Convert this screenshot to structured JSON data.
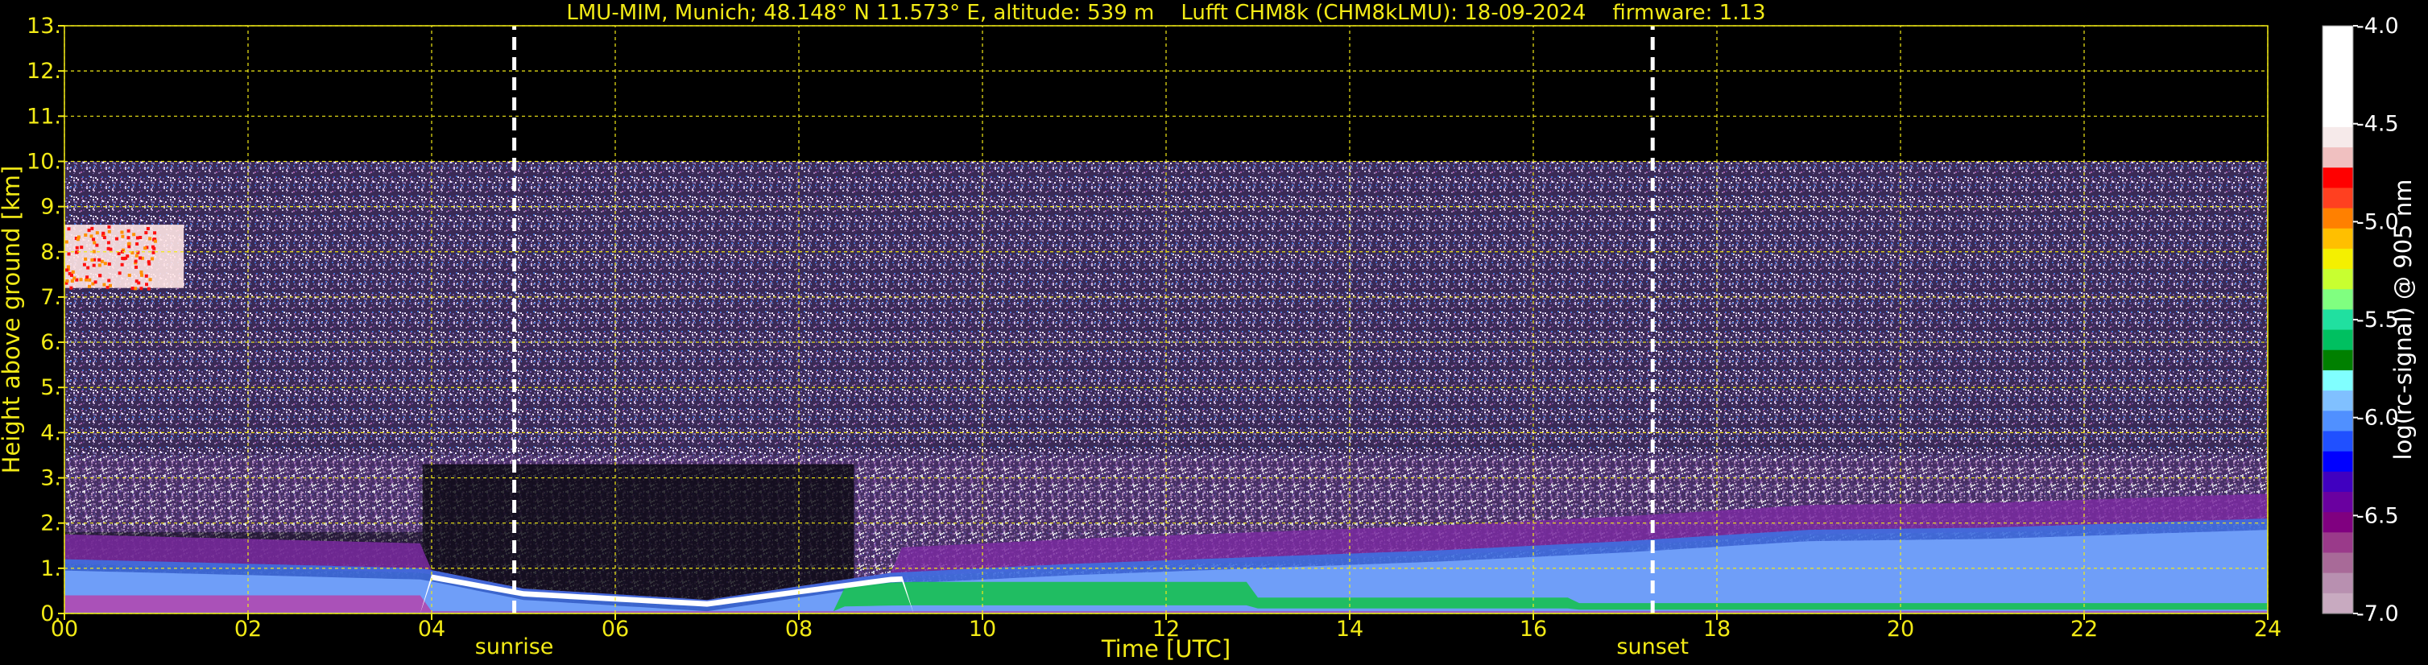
{
  "chart_data": {
    "type": "heatmap",
    "title": "LMU-MIM, Munich; 48.148° N 11.573° E, altitude: 539 m    Lufft CHM8k (CHM8kLMU): 18-09-2024    firmware: 1.13",
    "xlabel": "Time [UTC]",
    "ylabel": "Height above ground [km]",
    "colorbar_label": "log(rc-signal) @ 905 nm",
    "xlim": [
      0,
      24
    ],
    "ylim": [
      0,
      13
    ],
    "x_ticks": [
      0,
      2,
      4,
      6,
      8,
      10,
      12,
      14,
      16,
      18,
      20,
      22,
      24
    ],
    "x_tick_labels": [
      "00",
      "02",
      "04",
      "06",
      "08",
      "10",
      "12",
      "14",
      "16",
      "18",
      "20",
      "22",
      "24"
    ],
    "y_ticks": [
      0,
      1,
      2,
      3,
      4,
      5,
      6,
      7,
      8,
      9,
      10,
      11,
      12,
      13
    ],
    "y_tick_labels": [
      "0.",
      "1.",
      "2.",
      "3.",
      "4.",
      "5.",
      "6.",
      "7.",
      "8.",
      "9.",
      "10.",
      "11.",
      "12.",
      "13."
    ],
    "colorbar_range": [
      -7.0,
      -4.0
    ],
    "colorbar_ticks": [
      -4.0,
      -4.5,
      -5.0,
      -5.5,
      -6.0,
      -6.5,
      -7.0
    ],
    "colorbar_tick_labels": [
      "-4.0",
      "-4.5",
      "-5.0",
      "-5.5",
      "-6.0",
      "-6.5",
      "-7.0"
    ],
    "colorbar_colors": [
      "#ffffff",
      "#ffffff",
      "#ffffff",
      "#ffffff",
      "#ffffff",
      "#f6eaea",
      "#f0c0c0",
      "#ff0000",
      "#ff4020",
      "#ff8000",
      "#ffbf00",
      "#f4f000",
      "#c8ff30",
      "#80ff80",
      "#20e0a0",
      "#00c060",
      "#008000",
      "#80ffff",
      "#80c0ff",
      "#5090ff",
      "#2050ff",
      "#0000ff",
      "#4000c0",
      "#6a00a0",
      "#800080",
      "#9a3a8a",
      "#a86a98",
      "#b890b0",
      "#c8aac0"
    ],
    "measurement_range_km": 10,
    "markers": [
      {
        "label": "sunrise",
        "x": 4.9
      },
      {
        "label": "sunset",
        "x": 17.3
      }
    ],
    "boundary_layer_top_km": [
      {
        "t": 0.0,
        "h": 1.2
      },
      {
        "t": 2.0,
        "h": 1.1
      },
      {
        "t": 3.9,
        "h": 1.0
      },
      {
        "t": 5.0,
        "h": 0.55
      },
      {
        "t": 7.0,
        "h": 0.3
      },
      {
        "t": 9.0,
        "h": 0.9
      },
      {
        "t": 11.0,
        "h": 1.1
      },
      {
        "t": 13.0,
        "h": 1.25
      },
      {
        "t": 15.0,
        "h": 1.4
      },
      {
        "t": 17.0,
        "h": 1.6
      },
      {
        "t": 19.0,
        "h": 1.85
      },
      {
        "t": 21.0,
        "h": 1.9
      },
      {
        "t": 24.0,
        "h": 2.1
      }
    ],
    "cloud_layer": {
      "t_start": 0.0,
      "t_end": 1.3,
      "h_bottom_km": 7.2,
      "h_top_km": 8.6
    },
    "grid": true,
    "grid_color": "#f2ea16"
  }
}
